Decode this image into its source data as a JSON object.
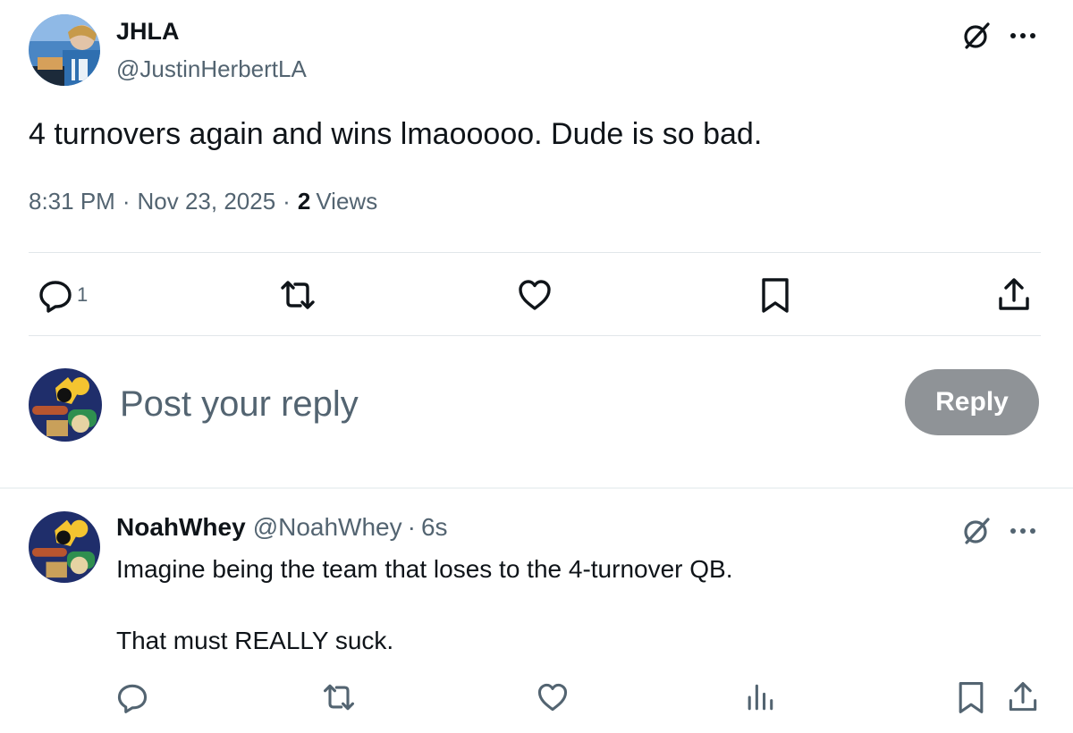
{
  "tweet": {
    "author_name": "JHLA",
    "author_handle": "@JustinHerbertLA",
    "text": "4 turnovers again and wins lmaooooo. Dude is so bad.",
    "time": "8:31 PM",
    "date": "Nov 23, 2025",
    "views_count": "2",
    "views_label": "Views",
    "reply_count": "1",
    "separator": "·"
  },
  "composer": {
    "placeholder": "Post your reply",
    "button_label": "Reply"
  },
  "reply": {
    "author_name": "NoahWhey",
    "author_handle": "@NoahWhey",
    "separator": "·",
    "time": "6s",
    "text_line1": "Imagine being the team that loses to the 4-turnover QB.",
    "text_line2": "That must REALLY suck."
  },
  "icons": {
    "grok": "grok-icon",
    "more": "more-icon",
    "reply": "reply-icon",
    "retweet": "retweet-icon",
    "like": "heart-icon",
    "bookmark": "bookmark-icon",
    "share": "share-icon",
    "views": "analytics-icon"
  },
  "colors": {
    "text_primary": "#0f1419",
    "text_secondary": "#536471",
    "reply_button_bg": "#8f9397",
    "divider": "#eff3f4"
  }
}
